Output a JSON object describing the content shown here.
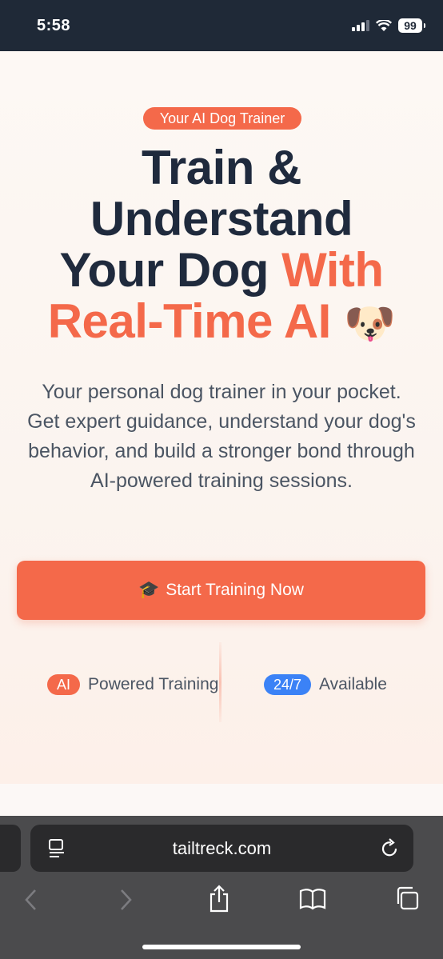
{
  "status_bar": {
    "time": "5:58",
    "battery": "99"
  },
  "hero": {
    "badge": "Your AI Dog Trainer",
    "headline_line1": "Train &",
    "headline_line2": "Understand",
    "headline_line3_dark": "Your Dog",
    "headline_line3_accent": "With",
    "headline_line4_accent": "Real-Time AI",
    "headline_emoji": "🐶",
    "subtitle": "Your personal dog trainer in your pocket. Get expert guidance, understand your dog's behavior, and build a stronger bond through AI-powered training sessions.",
    "cta_emoji": "🎓",
    "cta_label": "Start Training Now",
    "features": [
      {
        "pill": "AI",
        "label": "Powered Training"
      },
      {
        "pill": "24/7",
        "label": "Available"
      }
    ]
  },
  "browser": {
    "url": "tailtreck.com"
  },
  "colors": {
    "accent": "#f4694a",
    "dark": "#1f2a3d",
    "blue": "#3b82f6"
  }
}
